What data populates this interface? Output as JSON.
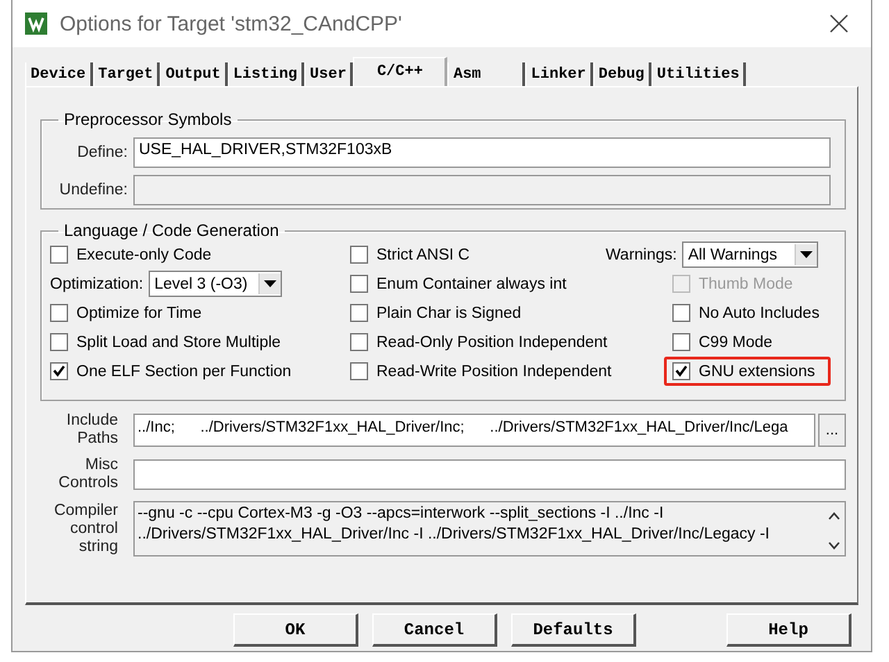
{
  "window": {
    "title": "Options for Target 'stm32_CAndCPP'"
  },
  "tabs": [
    {
      "label": "Device",
      "selected": false
    },
    {
      "label": "Target",
      "selected": false
    },
    {
      "label": "Output",
      "selected": false
    },
    {
      "label": "Listing",
      "selected": false
    },
    {
      "label": "User",
      "selected": false
    },
    {
      "label": "C/C++",
      "selected": true
    },
    {
      "label": "Asm",
      "selected": false
    },
    {
      "label": "Linker",
      "selected": false
    },
    {
      "label": "Debug",
      "selected": false
    },
    {
      "label": "Utilities",
      "selected": false
    }
  ],
  "preprocessor": {
    "title": "Preprocessor Symbols",
    "define": {
      "label": "Define:",
      "value": "USE_HAL_DRIVER,STM32F103xB",
      "disabled": false
    },
    "undefine": {
      "label": "Undefine:",
      "disabled": true
    }
  },
  "language": {
    "title": "Language / Code Generation",
    "columns": [
      [
        {
          "kind": "checkbox",
          "label": "Execute-only Code",
          "checked": false,
          "disabled": false,
          "highlighted": false
        },
        {
          "kind": "select",
          "label": "Optimization:",
          "value": "Level 3 (-O3)"
        },
        {
          "kind": "checkbox",
          "label": "Optimize for Time",
          "checked": false,
          "disabled": false,
          "highlighted": false
        },
        {
          "kind": "checkbox",
          "label": "Split Load and Store Multiple",
          "checked": false,
          "disabled": false,
          "highlighted": false
        },
        {
          "kind": "checkbox",
          "label": "One ELF Section per Function",
          "checked": true,
          "disabled": false,
          "highlighted": false
        }
      ],
      [
        {
          "kind": "checkbox",
          "label": "Strict ANSI C",
          "checked": false,
          "disabled": false,
          "highlighted": false
        },
        {
          "kind": "checkbox",
          "label": "Enum Container always int",
          "checked": false,
          "disabled": false,
          "highlighted": false
        },
        {
          "kind": "checkbox",
          "label": "Plain Char is Signed",
          "checked": false,
          "disabled": false,
          "highlighted": false
        },
        {
          "kind": "checkbox",
          "label": "Read-Only Position Independent",
          "checked": false,
          "disabled": false,
          "highlighted": false
        },
        {
          "kind": "checkbox",
          "label": "Read-Write Position Independent",
          "checked": false,
          "disabled": false,
          "highlighted": false
        }
      ],
      [
        {
          "kind": "select",
          "label": "Warnings:",
          "value": "All Warnings"
        },
        {
          "kind": "checkbox",
          "label": "Thumb Mode",
          "checked": false,
          "disabled": true,
          "highlighted": false
        },
        {
          "kind": "checkbox",
          "label": "No Auto Includes",
          "checked": false,
          "disabled": false,
          "highlighted": false
        },
        {
          "kind": "checkbox",
          "label": "C99 Mode",
          "checked": false,
          "disabled": false,
          "highlighted": false
        },
        {
          "kind": "checkbox",
          "label": "GNU extensions",
          "checked": true,
          "disabled": false,
          "highlighted": true
        }
      ]
    ]
  },
  "include_paths": {
    "label": "Include Paths",
    "value": "../Inc;      ../Drivers/STM32F1xx_HAL_Driver/Inc;      ../Drivers/STM32F1xx_HAL_Driver/Inc/Lega",
    "button": "..."
  },
  "misc_controls": {
    "label": "Misc Controls"
  },
  "compiler_control_string": {
    "label": "Compiler control string",
    "lines": [
      "--gnu -c --cpu Cortex-M3 -g -O3 --apcs=interwork --split_sections -I ../Inc -I",
      "../Drivers/STM32F1xx_HAL_Driver/Inc -I ../Drivers/STM32F1xx_HAL_Driver/Inc/Legacy -I"
    ]
  },
  "buttons": [
    {
      "label": "OK",
      "kind": "normal"
    },
    {
      "label": "Cancel",
      "kind": "normal"
    },
    {
      "label": "Defaults",
      "kind": "normal"
    },
    {
      "label": "Help",
      "kind": "right"
    }
  ]
}
